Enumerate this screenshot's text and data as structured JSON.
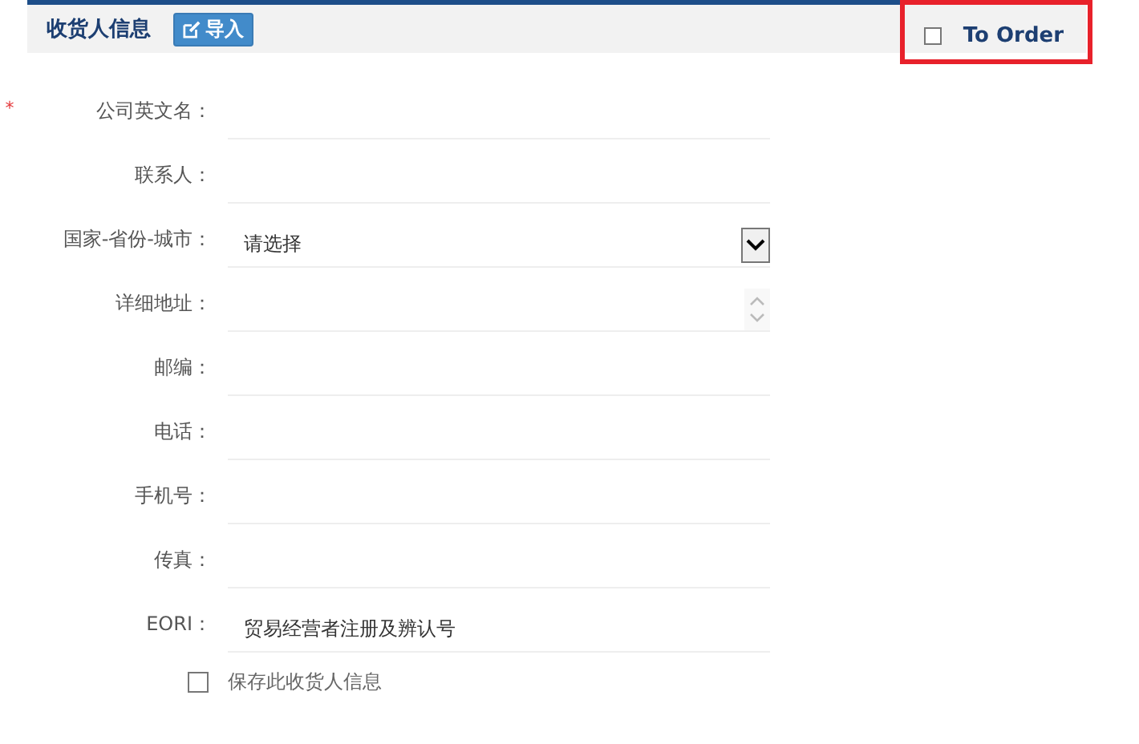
{
  "section": {
    "title": "收货人信息",
    "import_button": "导入",
    "to_order": {
      "label": "To Order",
      "checked": false,
      "highlighted": true
    }
  },
  "fields": [
    {
      "label": "公司英文名：",
      "kind": "text",
      "required_mark": "*"
    },
    {
      "label": "联系人：",
      "kind": "text"
    },
    {
      "label": "国家-省份-城市：",
      "kind": "select",
      "value": "请选择"
    },
    {
      "label": "详细地址：",
      "kind": "textarea"
    },
    {
      "label": "邮编：",
      "kind": "text"
    },
    {
      "label": "电话：",
      "kind": "text"
    },
    {
      "label": "手机号：",
      "kind": "text"
    },
    {
      "label": "传真：",
      "kind": "text"
    },
    {
      "label": "EORI：",
      "kind": "text",
      "value": "贸易经营者注册及辨认号"
    }
  ],
  "save": {
    "label": "保存此收货人信息",
    "checked": false
  }
}
